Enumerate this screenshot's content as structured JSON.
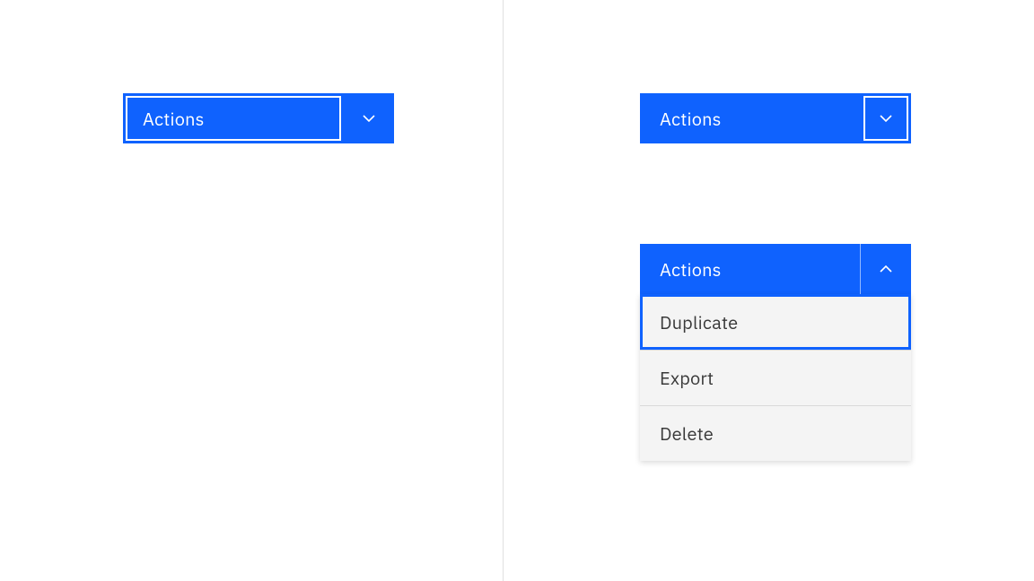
{
  "colors": {
    "primary": "#0f62fe",
    "menu_bg": "#f4f4f4",
    "menu_text": "#393939",
    "divider": "#e0e0e0"
  },
  "example1": {
    "label": "Actions",
    "state": "closed",
    "focus": "main-button"
  },
  "example2": {
    "label": "Actions",
    "state": "closed",
    "focus": "caret-button"
  },
  "example3": {
    "label": "Actions",
    "state": "open",
    "focus": "menu-item-0",
    "menu": [
      {
        "label": "Duplicate"
      },
      {
        "label": "Export"
      },
      {
        "label": "Delete"
      }
    ]
  }
}
